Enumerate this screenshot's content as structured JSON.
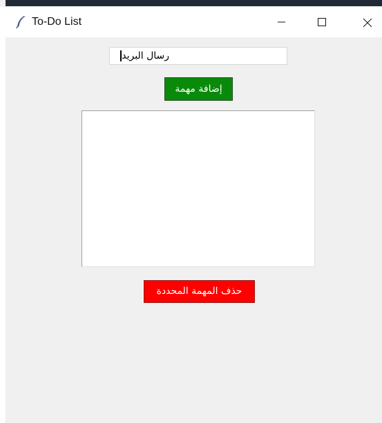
{
  "window": {
    "title": "To-Do List",
    "icon": "feather-icon",
    "controls": {
      "minimize_icon": "minimize-icon",
      "maximize_icon": "maximize-icon",
      "close_icon": "close-icon"
    }
  },
  "task_entry": {
    "value": "رسال البريد"
  },
  "add_button": {
    "label": "إضافة مهمة",
    "color": "#0a8a0a"
  },
  "task_list": {
    "items": []
  },
  "delete_button": {
    "label": "حذف المهمة المحددة",
    "color": "#ff0000"
  }
}
